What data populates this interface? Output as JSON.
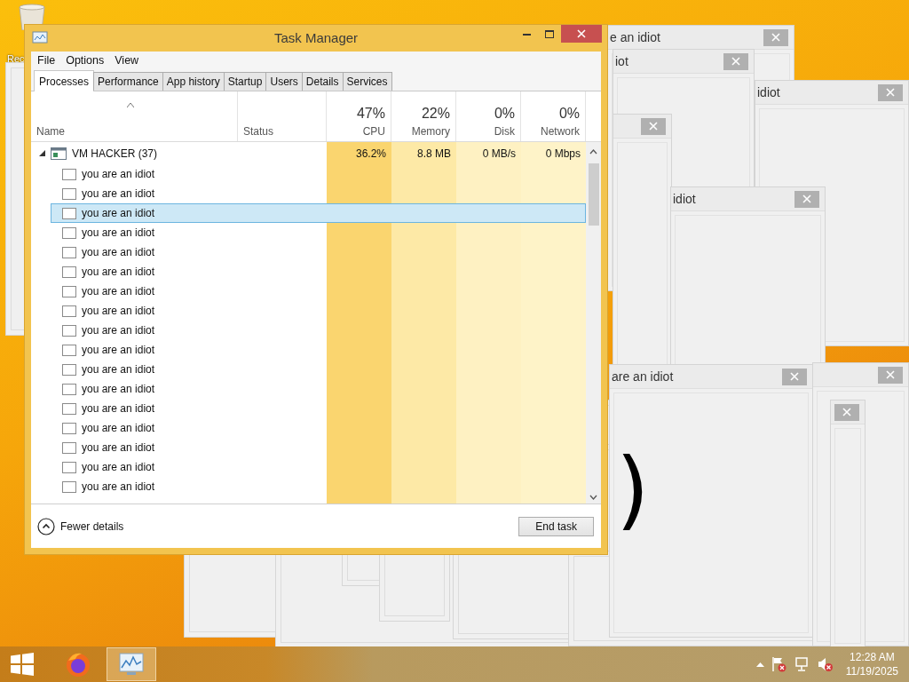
{
  "desktop": {
    "icons": [
      {
        "label": "Rec"
      }
    ]
  },
  "background_windows": [
    {
      "kind": "popup",
      "title": "e an idiot"
    },
    {
      "kind": "popup",
      "title": "iot"
    },
    {
      "kind": "popup",
      "title": "idiot"
    },
    {
      "kind": "popup"
    },
    {
      "kind": "popup",
      "title": "idiot"
    },
    {
      "kind": "popup",
      "title": "are an idiot",
      "content": ")"
    },
    {
      "kind": "popup"
    },
    {
      "kind": "popup"
    }
  ],
  "task_manager": {
    "title": "Task Manager",
    "menu": [
      "File",
      "Options",
      "View"
    ],
    "tabs": [
      {
        "label": "Processes",
        "selected": true
      },
      {
        "label": "Performance",
        "selected": false
      },
      {
        "label": "App history",
        "selected": false
      },
      {
        "label": "Startup",
        "selected": false
      },
      {
        "label": "Users",
        "selected": false
      },
      {
        "label": "Details",
        "selected": false
      },
      {
        "label": "Services",
        "selected": false
      }
    ],
    "columns": [
      {
        "label": "Name"
      },
      {
        "label": "Status"
      },
      {
        "percent": "47%",
        "label": "CPU"
      },
      {
        "percent": "22%",
        "label": "Memory"
      },
      {
        "percent": "0%",
        "label": "Disk"
      },
      {
        "percent": "0%",
        "label": "Network"
      }
    ],
    "groups": [
      {
        "name": "VM HACKER (37)",
        "expanded": true,
        "cpu": "36.2%",
        "memory": "8.8 MB",
        "disk": "0 MB/s",
        "network": "0 Mbps",
        "children": [
          {
            "name": "you are an idiot",
            "selected": false
          },
          {
            "name": "you are an idiot",
            "selected": false
          },
          {
            "name": "you are an idiot",
            "selected": true
          },
          {
            "name": "you are an idiot",
            "selected": false
          },
          {
            "name": "you are an idiot",
            "selected": false
          },
          {
            "name": "you are an idiot",
            "selected": false
          },
          {
            "name": "you are an idiot",
            "selected": false
          },
          {
            "name": "you are an idiot",
            "selected": false
          },
          {
            "name": "you are an idiot",
            "selected": false
          },
          {
            "name": "you are an idiot",
            "selected": false
          },
          {
            "name": "you are an idiot",
            "selected": false
          },
          {
            "name": "you are an idiot",
            "selected": false
          },
          {
            "name": "you are an idiot",
            "selected": false
          },
          {
            "name": "you are an idiot",
            "selected": false
          },
          {
            "name": "you are an idiot",
            "selected": false
          },
          {
            "name": "you are an idiot",
            "selected": false
          },
          {
            "name": "you are an idiot",
            "selected": false
          }
        ]
      }
    ],
    "footer": {
      "toggle": "Fewer details",
      "button": "End task"
    }
  },
  "taskbar": {
    "apps": [
      {
        "kind": "browser",
        "active": false
      },
      {
        "kind": "task-manager",
        "active": true
      }
    ],
    "clock": {
      "time": "12:28 AM",
      "date": "11/19/2025"
    }
  }
}
